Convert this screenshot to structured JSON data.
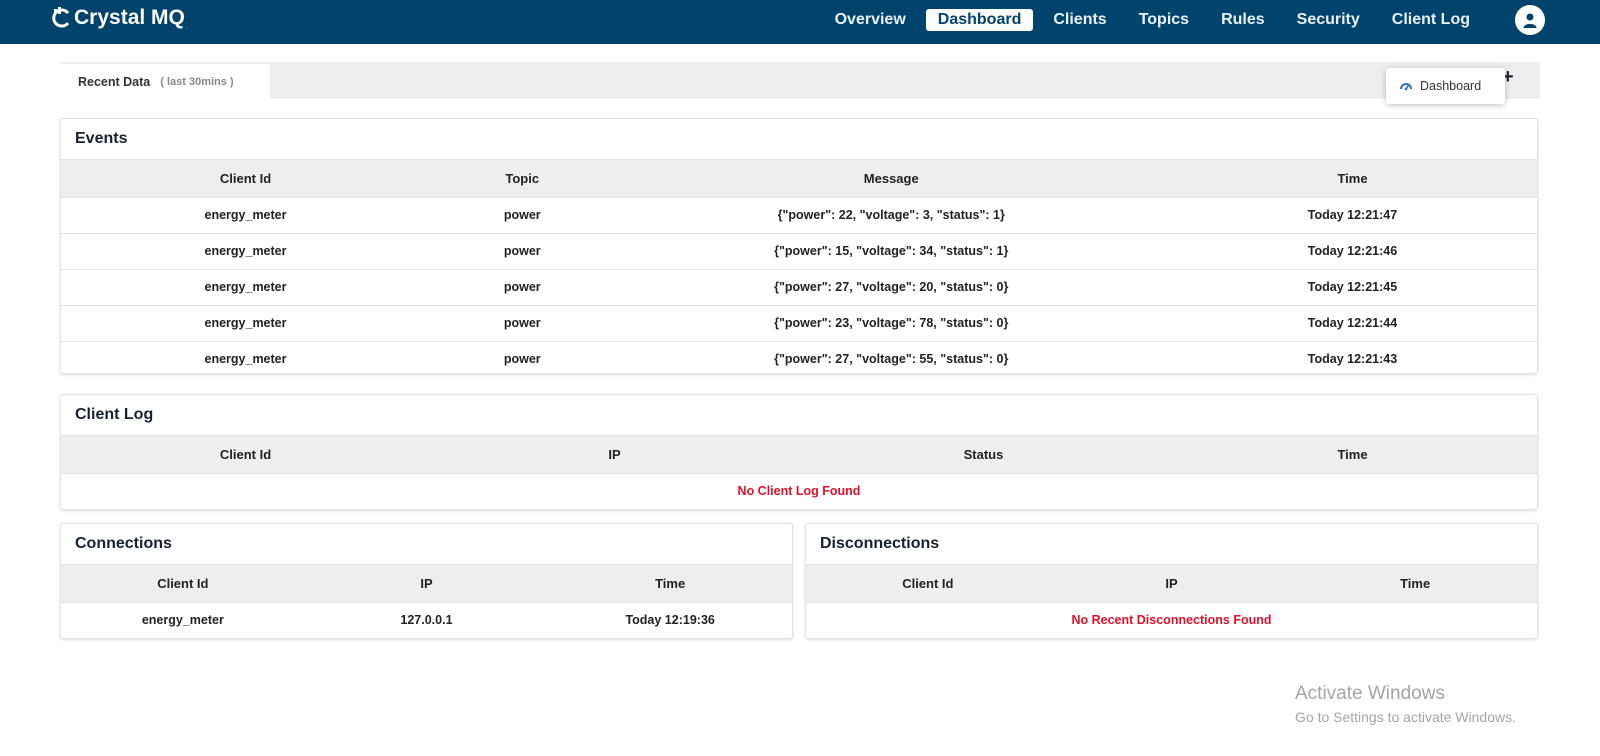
{
  "brand": {
    "name": "Crystal MQ"
  },
  "nav": {
    "items": [
      {
        "label": "Overview",
        "active": false
      },
      {
        "label": "Dashboard",
        "active": true
      },
      {
        "label": "Clients",
        "active": false
      },
      {
        "label": "Topics",
        "active": false
      },
      {
        "label": "Rules",
        "active": false
      },
      {
        "label": "Security",
        "active": false
      },
      {
        "label": "Client Log",
        "active": false
      }
    ]
  },
  "tabs": {
    "recent_label": "Recent Data",
    "recent_sub": "( last 30mins )",
    "add_symbol": "+",
    "dropdown_label": "Dashboard"
  },
  "events": {
    "title": "Events",
    "columns": [
      "Client Id",
      "Topic",
      "Message",
      "Time"
    ],
    "rows": [
      [
        "energy_meter",
        "power",
        "{\"power\": 22, \"voltage\": 3, \"status\": 1}",
        "Today 12:21:47"
      ],
      [
        "energy_meter",
        "power",
        "{\"power\": 15, \"voltage\": 34, \"status\": 1}",
        "Today 12:21:46"
      ],
      [
        "energy_meter",
        "power",
        "{\"power\": 27, \"voltage\": 20, \"status\": 0}",
        "Today 12:21:45"
      ],
      [
        "energy_meter",
        "power",
        "{\"power\": 23, \"voltage\": 78, \"status\": 0}",
        "Today 12:21:44"
      ],
      [
        "energy_meter",
        "power",
        "{\"power\": 27, \"voltage\": 55, \"status\": 0}",
        "Today 12:21:43"
      ]
    ]
  },
  "client_log": {
    "title": "Client Log",
    "columns": [
      "Client Id",
      "IP",
      "Status",
      "Time"
    ],
    "empty": "No Client Log Found"
  },
  "connections": {
    "title": "Connections",
    "columns": [
      "Client Id",
      "IP",
      "Time"
    ],
    "rows": [
      [
        "energy_meter",
        "127.0.0.1",
        "Today 12:19:36"
      ]
    ]
  },
  "disconnections": {
    "title": "Disconnections",
    "columns": [
      "Client Id",
      "IP",
      "Time"
    ],
    "empty": "No Recent Disconnections Found"
  },
  "watermark": {
    "title": "Activate Windows",
    "subtitle": "Go to Settings to activate Windows."
  },
  "colors": {
    "navbar": "#00446e",
    "empty_text": "#e0102a",
    "header_bg": "#eeeeee"
  }
}
